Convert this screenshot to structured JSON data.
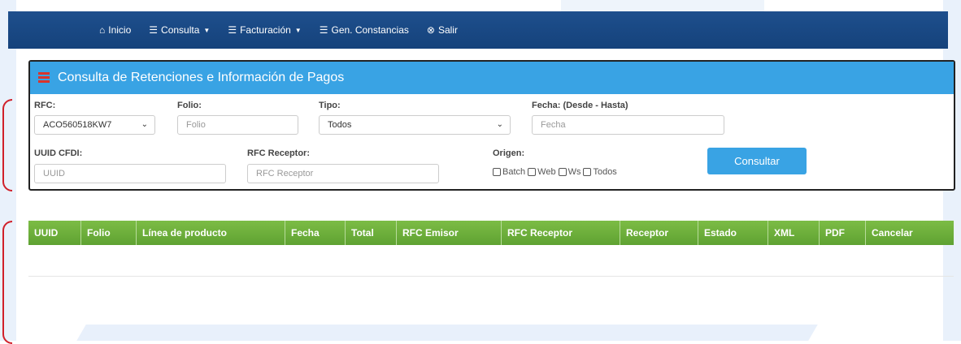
{
  "nav": {
    "items": [
      {
        "icon": "home-icon",
        "glyph": "⌂",
        "label": "Inicio",
        "caret": false
      },
      {
        "icon": "list-icon",
        "glyph": "☰",
        "label": "Consulta",
        "caret": true
      },
      {
        "icon": "list-icon",
        "glyph": "☰",
        "label": "Facturación",
        "caret": true
      },
      {
        "icon": "list-icon",
        "glyph": "☰",
        "label": "Gen. Constancias",
        "caret": false
      },
      {
        "icon": "close-circle-icon",
        "glyph": "⊗",
        "label": "Salir",
        "caret": false
      }
    ]
  },
  "panel": {
    "title": "Consulta de Retenciones e Información de Pagos"
  },
  "form": {
    "rfc": {
      "label": "RFC:",
      "value": "ACO560518KW7"
    },
    "folio": {
      "label": "Folio:",
      "placeholder": "Folio"
    },
    "tipo": {
      "label": "Tipo:",
      "value": "Todos"
    },
    "fecha": {
      "label": "Fecha: (Desde - Hasta)",
      "placeholder": "Fecha"
    },
    "uuid": {
      "label": "UUID CFDI:",
      "placeholder": "UUID"
    },
    "rfc_receptor": {
      "label": "RFC Receptor:",
      "placeholder": "RFC Receptor"
    },
    "origen": {
      "label": "Origen:",
      "options": [
        "Batch",
        "Web",
        "Ws",
        "Todos"
      ]
    },
    "submit": "Consultar"
  },
  "table": {
    "columns": [
      "UUID",
      "Folio",
      "Línea de producto",
      "Fecha",
      "Total",
      "RFC Emisor",
      "RFC Receptor",
      "Receptor",
      "Estado",
      "XML",
      "PDF",
      "Cancelar"
    ]
  },
  "colors": {
    "navbar": "#1a4a86",
    "panel_header": "#39a3e4",
    "table_header": "#6cad3b",
    "annotation": "#d0202a"
  }
}
